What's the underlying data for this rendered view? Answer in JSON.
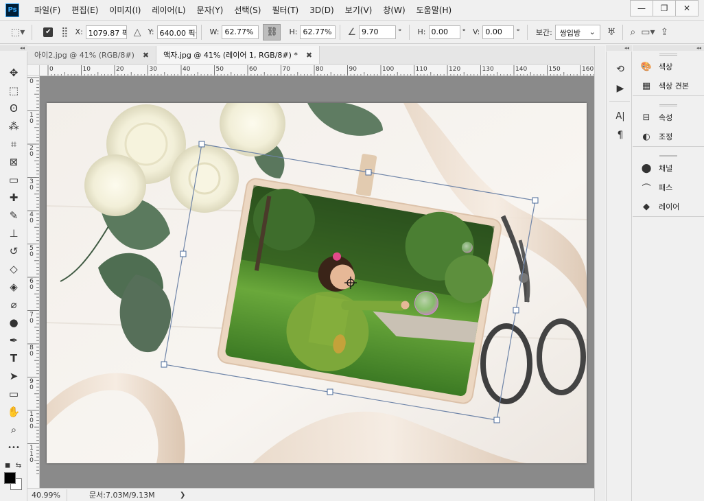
{
  "app": {
    "logo": "Ps"
  },
  "menubar": {
    "items": [
      "파일(F)",
      "편집(E)",
      "이미지(I)",
      "레이어(L)",
      "문자(Y)",
      "선택(S)",
      "필터(T)",
      "3D(D)",
      "보기(V)",
      "창(W)",
      "도움말(H)"
    ],
    "window_controls": [
      "—",
      "❐",
      "✕"
    ]
  },
  "options": {
    "x_label": "X:",
    "x_value": "1079.87 픽",
    "y_label": "Y:",
    "y_value": "640.00 픽셀",
    "w_label": "W:",
    "w_value": "62.77%",
    "h_label": "H:",
    "h_value": "62.77%",
    "angle_value": "9.70",
    "angle_unit": "°",
    "hskew_label": "H:",
    "hskew_value": "0.00",
    "hskew_unit": "°",
    "vskew_label": "V:",
    "vskew_value": "0.00",
    "vskew_unit": "°",
    "interp_label": "보간:",
    "interp_value": "쌍입방",
    "link_icon": "⛓"
  },
  "collapse_glyph": "◂◂",
  "tabs": [
    {
      "label": "아이2.jpg @ 41% (RGB/8#)",
      "close": "✖",
      "active": false
    },
    {
      "label": "액자.jpg @ 41% (레이어 1, RGB/8#) *",
      "close": "✖",
      "active": true
    }
  ],
  "ruler": {
    "h_labels": [
      "0",
      "10",
      "20",
      "30",
      "40",
      "50",
      "60",
      "70",
      "80",
      "90",
      "100",
      "110",
      "120",
      "130",
      "140",
      "150",
      "160"
    ],
    "v_labels": [
      "0",
      "1 0",
      "2 0",
      "3 0",
      "4 0",
      "5 0",
      "6 0",
      "7 0",
      "8 0",
      "9 0",
      "1 0 0",
      "1 1 0"
    ]
  },
  "toolbar": {
    "tools": [
      {
        "name": "move-tool-icon",
        "glyph": "✥"
      },
      {
        "name": "marquee-tool-icon",
        "glyph": "⬚"
      },
      {
        "name": "lasso-tool-icon",
        "glyph": "ʘ"
      },
      {
        "name": "magic-wand-tool-icon",
        "glyph": "⁂"
      },
      {
        "name": "crop-tool-icon",
        "glyph": "⌗"
      },
      {
        "name": "frame-tool-icon",
        "glyph": "⊠"
      },
      {
        "name": "eyedropper-tool-icon",
        "glyph": "▭"
      },
      {
        "name": "healing-brush-tool-icon",
        "glyph": "✚"
      },
      {
        "name": "brush-tool-icon",
        "glyph": "✎"
      },
      {
        "name": "clone-stamp-tool-icon",
        "glyph": "⊥"
      },
      {
        "name": "history-brush-tool-icon",
        "glyph": "↺"
      },
      {
        "name": "eraser-tool-icon",
        "glyph": "◇"
      },
      {
        "name": "paint-bucket-tool-icon",
        "glyph": "◈"
      },
      {
        "name": "blur-tool-icon",
        "glyph": "⌀"
      },
      {
        "name": "dodge-tool-icon",
        "glyph": "●"
      },
      {
        "name": "pen-tool-icon",
        "glyph": "✒"
      },
      {
        "name": "type-tool-icon",
        "glyph": "T"
      },
      {
        "name": "path-selection-tool-icon",
        "glyph": "➤"
      },
      {
        "name": "rectangle-tool-icon",
        "glyph": "▭"
      },
      {
        "name": "hand-tool-icon",
        "glyph": "✋"
      },
      {
        "name": "zoom-tool-icon",
        "glyph": "⌕"
      },
      {
        "name": "more-tools-icon",
        "glyph": "•••"
      }
    ]
  },
  "status": {
    "zoom": "40.99%",
    "doc_info": "문서:7.03M/9.13M",
    "arrow": "❯"
  },
  "iconbar": {
    "buttons": [
      {
        "name": "history-icon",
        "glyph": "⟲"
      },
      {
        "name": "actions-play-icon",
        "glyph": "▶"
      },
      {
        "name": "character-icon",
        "glyph": "A|"
      },
      {
        "name": "paragraph-icon",
        "glyph": "¶"
      }
    ]
  },
  "panels": {
    "group1": [
      {
        "name": "color-panel",
        "icon": "🎨",
        "label": "색상"
      },
      {
        "name": "swatches-panel",
        "icon": "▦",
        "label": "색상 견본"
      }
    ],
    "group2": [
      {
        "name": "properties-panel",
        "icon": "⊟",
        "label": "속성"
      },
      {
        "name": "adjustments-panel",
        "icon": "◐",
        "label": "조정"
      }
    ],
    "group3": [
      {
        "name": "channels-panel",
        "icon": "⬤",
        "label": "채널"
      },
      {
        "name": "paths-panel",
        "icon": "⌒",
        "label": "패스"
      },
      {
        "name": "layers-panel",
        "icon": "◆",
        "label": "레이어"
      }
    ]
  },
  "colors": {
    "accent": "#31a8ff",
    "foreground": "#000000",
    "background": "#ffffff",
    "transform_box": "#6e84a8"
  }
}
